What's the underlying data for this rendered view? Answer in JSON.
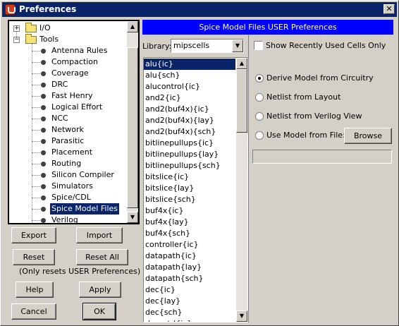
{
  "window": {
    "title": "Preferences",
    "close_glyph": "✕"
  },
  "tree": {
    "items": [
      {
        "label": "I/O",
        "type": "folder",
        "expander": "+"
      },
      {
        "label": "Tools",
        "type": "folder",
        "expander": "−"
      },
      {
        "label": "Antenna Rules",
        "type": "leaf"
      },
      {
        "label": "Compaction",
        "type": "leaf"
      },
      {
        "label": "Coverage",
        "type": "leaf"
      },
      {
        "label": "DRC",
        "type": "leaf"
      },
      {
        "label": "Fast Henry",
        "type": "leaf"
      },
      {
        "label": "Logical Effort",
        "type": "leaf"
      },
      {
        "label": "NCC",
        "type": "leaf"
      },
      {
        "label": "Network",
        "type": "leaf"
      },
      {
        "label": "Parasitic",
        "type": "leaf"
      },
      {
        "label": "Placement",
        "type": "leaf"
      },
      {
        "label": "Routing",
        "type": "leaf"
      },
      {
        "label": "Silicon Compiler",
        "type": "leaf"
      },
      {
        "label": "Simulators",
        "type": "leaf"
      },
      {
        "label": "Spice/CDL",
        "type": "leaf"
      },
      {
        "label": "Spice Model Files",
        "type": "leaf",
        "selected": true
      },
      {
        "label": "Verilog",
        "type": "leaf"
      }
    ]
  },
  "buttons": {
    "export": "Export",
    "import": "Import",
    "reset": "Reset",
    "reset_all": "Reset All",
    "reset_note": "(Only resets USER Preferences)",
    "help": "Help",
    "apply": "Apply",
    "cancel": "Cancel",
    "ok": "OK",
    "browse": "Browse"
  },
  "panel": {
    "header": "Spice Model Files USER Preferences",
    "library_label": "Library:",
    "library_value": "mipscells",
    "show_recent_label": "Show Recently Used Cells Only",
    "show_recent_checked": false,
    "options": [
      {
        "label": "Derive Model from Circuitry",
        "checked": true
      },
      {
        "label": "Netlist from Layout",
        "checked": false
      },
      {
        "label": "Netlist from Verilog View",
        "checked": false
      },
      {
        "label": "Use Model from File:",
        "checked": false
      }
    ],
    "file_path": ""
  },
  "cells": {
    "items": [
      "alu{ic}",
      "alu{sch}",
      "alucontrol{ic}",
      "and2{ic}",
      "and2(buf4x){ic}",
      "and2(buf4x){lay}",
      "and2(buf4x){sch}",
      "bitlinepullups{ic}",
      "bitlinepullups{lay}",
      "bitlinepullups{sch}",
      "bitslice{ic}",
      "bitslice{lay}",
      "bitslice{sch}",
      "buf4x{ic}",
      "buf4x{lay}",
      "buf4x{sch}",
      "controller{ic}",
      "datapath{ic}",
      "datapath{lay}",
      "datapath{sch}",
      "dec{ic}",
      "dec{lay}",
      "dec{sch}",
      "dec_ctrl{ic}"
    ],
    "selected_index": 0
  },
  "icons": {
    "scroll_up": "▲",
    "scroll_down": "▼",
    "combo_arrow": "▼"
  }
}
